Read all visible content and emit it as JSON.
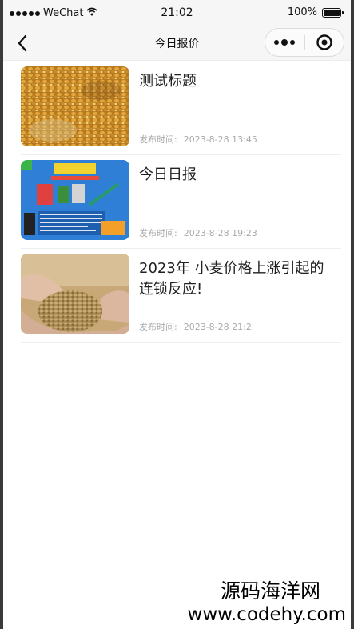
{
  "status_bar": {
    "carrier": "WeChat",
    "time": "21:02",
    "battery": "100%"
  },
  "nav": {
    "title": "今日报价",
    "back_icon": "chevron-left-icon",
    "more_icon": "more-dots-icon",
    "close_icon": "target-icon"
  },
  "articles": [
    {
      "title": "测试标题",
      "time_label": "发布时间:",
      "time": "2023-8-28 13:45",
      "image": "corn-kernels-photo"
    },
    {
      "title": "今日日报",
      "time_label": "发布时间:",
      "time": "2023-8-28 19:23",
      "image": "machinery-poster"
    },
    {
      "title": "2023年 小麦价格上涨引起的连锁反应!",
      "time_label": "发布时间:",
      "time": "2023-8-28 21:2",
      "image": "wheat-in-hands-photo"
    }
  ],
  "watermark": {
    "cn": "源码海洋网",
    "url": "www.codehy.com"
  }
}
